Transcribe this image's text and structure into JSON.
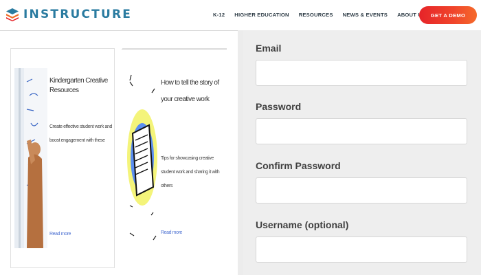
{
  "header": {
    "brand": "INSTRUCTURE",
    "nav": [
      "K-12",
      "HIGHER EDUCATION",
      "RESOURCES",
      "NEWS & EVENTS",
      "ABOUT US"
    ],
    "cta": "GET A DEMO"
  },
  "cards": [
    {
      "title": "Kindergarten Creative Resources",
      "body": "Create effective student work and boost engagement with these",
      "link": "Read more"
    },
    {
      "title": "How to tell the story of your creative work",
      "body": "Tips for showcasing creative student work and sharing it with others",
      "link": "Read more"
    }
  ],
  "form": {
    "fields": [
      {
        "label": "Email",
        "value": "",
        "placeholder": ""
      },
      {
        "label": "Password",
        "value": "",
        "placeholder": ""
      },
      {
        "label": "Confirm Password",
        "value": "",
        "placeholder": ""
      },
      {
        "label": "Username (optional)",
        "value": "",
        "placeholder": ""
      }
    ]
  },
  "colors": {
    "brand": "#2a7ba0",
    "cta_start": "#e62429",
    "cta_end": "#f56a2b",
    "form_bg": "#eeeeee"
  }
}
